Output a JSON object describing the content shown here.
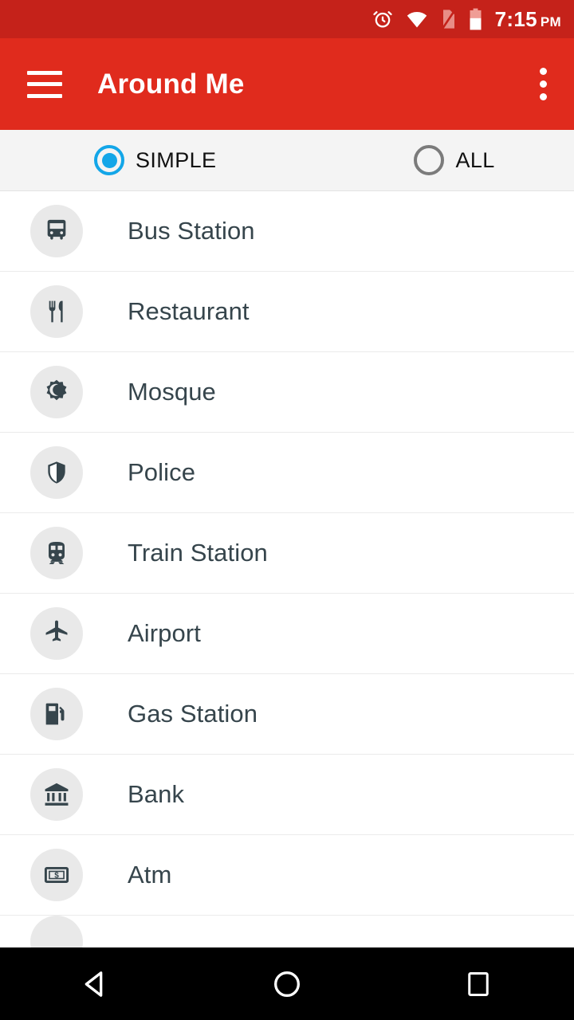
{
  "statusbar": {
    "time": "7:15",
    "ampm": "PM",
    "icons": [
      "alarm-icon",
      "wifi-icon",
      "no-sim-icon",
      "battery-icon"
    ]
  },
  "appbar": {
    "title": "Around Me",
    "menu_icon": "hamburger-menu-icon",
    "overflow_icon": "overflow-menu-icon",
    "background": "#e02b1d"
  },
  "filter": {
    "accent_color": "#13a6e8",
    "options": [
      {
        "label": "SIMPLE",
        "selected": true
      },
      {
        "label": "ALL",
        "selected": false
      }
    ]
  },
  "list": {
    "items": [
      {
        "label": "Bus Station",
        "icon": "bus-icon"
      },
      {
        "label": "Restaurant",
        "icon": "restaurant-icon"
      },
      {
        "label": "Mosque",
        "icon": "mosque-icon"
      },
      {
        "label": "Police",
        "icon": "shield-icon"
      },
      {
        "label": "Train Station",
        "icon": "train-icon"
      },
      {
        "label": "Airport",
        "icon": "airplane-icon"
      },
      {
        "label": "Gas Station",
        "icon": "gas-pump-icon"
      },
      {
        "label": "Bank",
        "icon": "bank-icon"
      },
      {
        "label": "Atm",
        "icon": "atm-icon"
      }
    ]
  },
  "navbar": {
    "back": "back-triangle-icon",
    "home": "home-circle-icon",
    "recents": "recents-square-icon"
  }
}
